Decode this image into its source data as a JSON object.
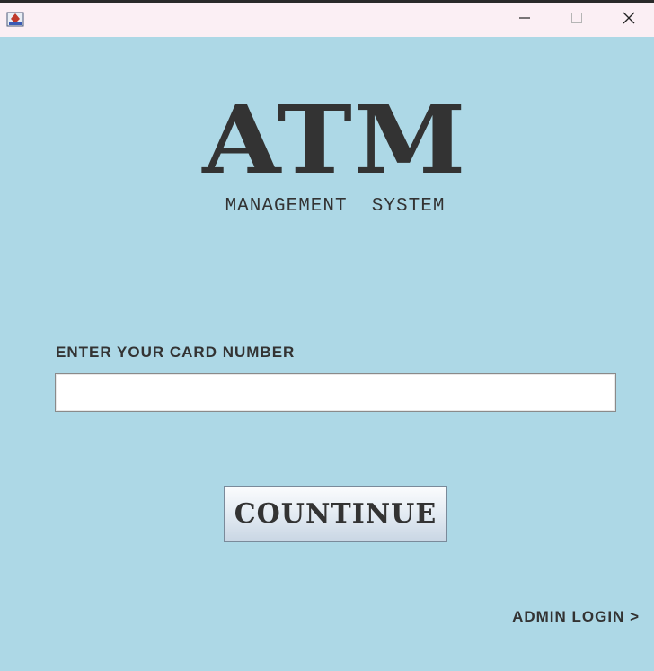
{
  "window": {
    "app_icon": "java-app-icon",
    "controls": {
      "minimize_icon": "minimize-icon",
      "maximize_icon": "maximize-icon",
      "close_icon": "close-icon"
    }
  },
  "logo": {
    "title": "ATM",
    "subtitle": "MANAGEMENT  SYSTEM"
  },
  "card_entry": {
    "label": "ENTER YOUR CARD NUMBER",
    "value": "",
    "placeholder": ""
  },
  "actions": {
    "continue_label": "COUNTINUE",
    "admin_login_label": "ADMIN LOGIN >"
  },
  "colors": {
    "background": "#add8e6",
    "titlebar": "#fbeff4",
    "text": "#333333"
  }
}
